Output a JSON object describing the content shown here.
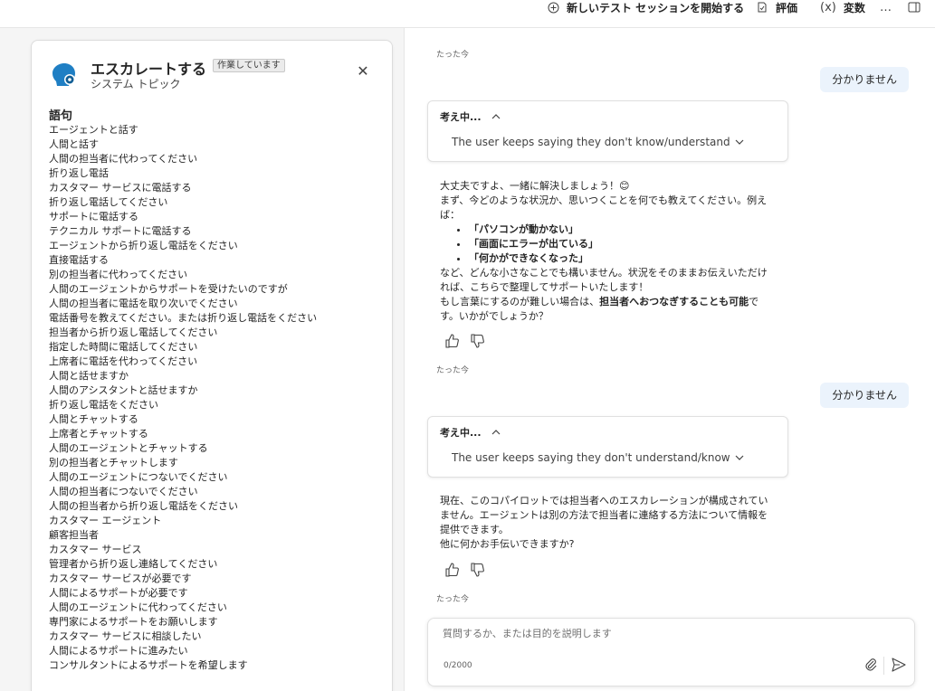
{
  "toolbar": {
    "new_test_session": "新しいテスト セッションを開始する",
    "evaluate": "評価",
    "variables": "変数",
    "more": "…",
    "icons": [
      "add-icon",
      "evaluate-icon",
      "variable-icon",
      "more-icon",
      "panel-icon"
    ]
  },
  "topic": {
    "title": "エスカレートする",
    "badge": "作業しています",
    "subtitle": "システム トピック",
    "close": "✕",
    "phrases_heading": "語句",
    "phrases": [
      "エージェントと話す",
      "人間と話す",
      "人間の担当者に代わってください",
      "折り返し電話",
      "カスタマー サービスに電話する",
      "折り返し電話してください",
      "サポートに電話する",
      "テクニカル サポートに電話する",
      "エージェントから折り返し電話をください",
      "直接電話する",
      "別の担当者に代わってください",
      "人間のエージェントからサポートを受けたいのですが",
      "人間の担当者に電話を取り次いでください",
      "電話番号を教えてください。または折り返し電話をください",
      "担当者から折り返し電話してください",
      "指定した時間に電話してください",
      "上席者に電話を代わってください",
      "人間と話せますか",
      "人間のアシスタントと話せますか",
      "折り返し電話をください",
      "人間とチャットする",
      "上席者とチャットする",
      "人間のエージェントとチャットする",
      "別の担当者とチャットします",
      "人間のエージェントにつないでください",
      "人間の担当者につないでください",
      "人間の担当者から折り返し電話をください",
      "カスタマー エージェント",
      "顧客担当者",
      "カスタマー サービス",
      "管理者から折り返し連絡してください",
      "カスタマー サービスが必要です",
      "人間によるサポートが必要です",
      "人間のエージェントに代わってください",
      "専門家によるサポートをお願いします",
      "カスタマー サービスに相談したい",
      "人間によるサポートに進みたい",
      "コンサルタントによるサポートを希望します"
    ]
  },
  "chat": {
    "timestamp": "たった今",
    "user_message": "分かりません",
    "thinking_label": "考え中...",
    "thinking_1": "The user keeps saying they don't know/understand",
    "thinking_2": "The user keeps saying they don't understand/know",
    "bot1": {
      "line1": "大丈夫ですよ、一緒に解決しましょう！😊",
      "line2": "まず、今どのような状況か、思いつくことを何でも教えてください。例えば：",
      "bullets": [
        "「パソコンが動かない」",
        "「画面にエラーが出ている」",
        "「何かができなくなった」"
      ],
      "line3": "など、どんな小さなことでも構いません。状況をそのままお伝えいただければ、こちらで整理してサポートいたします！",
      "line4_pre": "もし言葉にするのが難しい場合は、",
      "line4_bold": "担当者へおつなぎすることも可能",
      "line4_post": "です。いかがでしょうか？"
    },
    "bot2": {
      "line1": "現在、このコパイロットでは担当者へのエスカレーションが構成されていません。エージェントは別の方法で担当者に連絡する方法について情報を提供できます。",
      "line2": "他に何かお手伝いできますか?"
    },
    "input": {
      "placeholder": "質問するか、または目的を説明します",
      "counter": "0/2000"
    }
  }
}
